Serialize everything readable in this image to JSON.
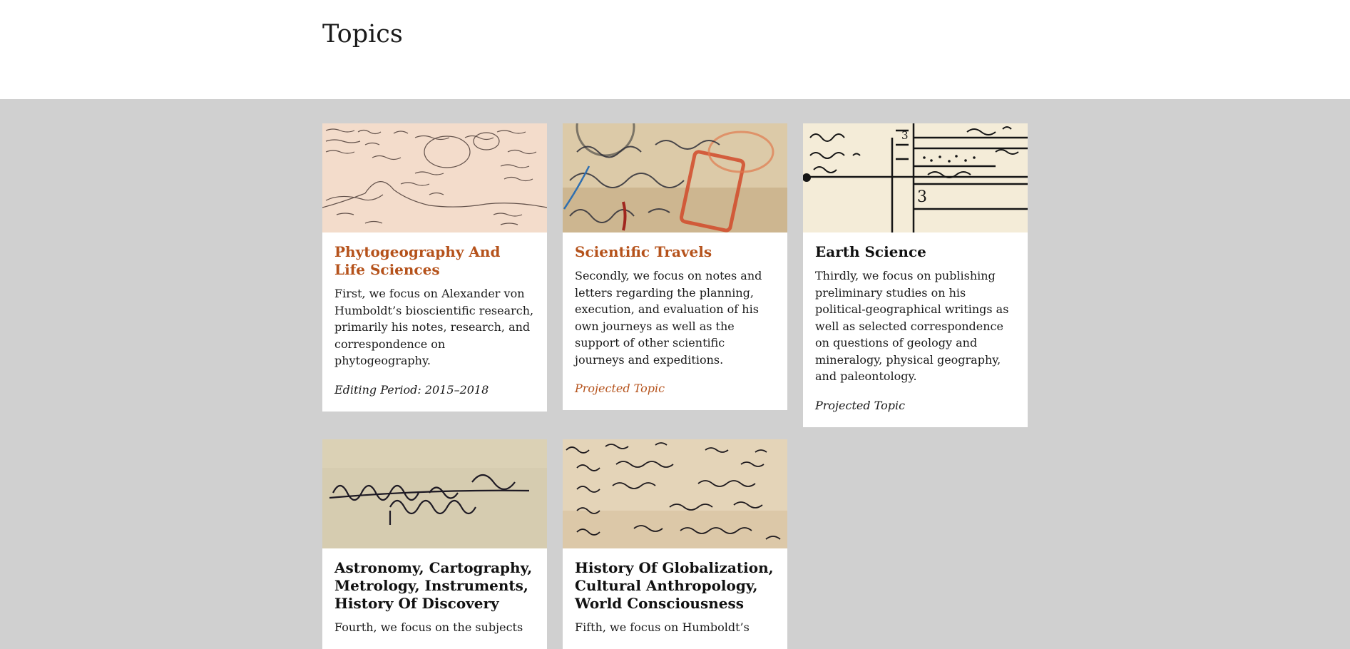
{
  "page": {
    "title": "Topics"
  },
  "colors": {
    "accent": "#b5521b",
    "background": "#d0d0d0",
    "card": "#ffffff"
  },
  "topics": [
    {
      "title": "Phytogeography And Life Sciences",
      "description": "First, we focus on Alexander von Humboldt’s bioscientific research, primarily his notes, research, and correspondence on phytogeography.",
      "meta": "Editing Period: 2015–2018",
      "image": "handwritten-notes-with-sketch"
    },
    {
      "title": "Scientific Travels",
      "description": "Secondly, we focus on notes and letters regarding the planning, execution, and evaluation of his own journeys as well as the support of other scientific journeys and expeditions.",
      "meta": "Projected Topic",
      "image": "stamped-letter-envelope"
    },
    {
      "title": "Earth Science",
      "description": "Thirdly, we focus on publishing preliminary studies on his political-geographical writings as well as selected correspondence on questions of geology and mineralogy, physical geography, and paleontology.",
      "meta": "Projected Topic",
      "image": "geological-strata-sketch"
    },
    {
      "title": "Astronomy, Cartography, Metrology, Instruments, History Of Discovery",
      "description": "Fourth, we focus on the subjects",
      "meta": "",
      "image": "handwritten-instruments-title"
    },
    {
      "title": "History Of Globalization, Cultural Anthropology, World Consciousness",
      "description": "Fifth, we focus on Humboldt’s",
      "meta": "",
      "image": "handwritten-list-page"
    }
  ]
}
